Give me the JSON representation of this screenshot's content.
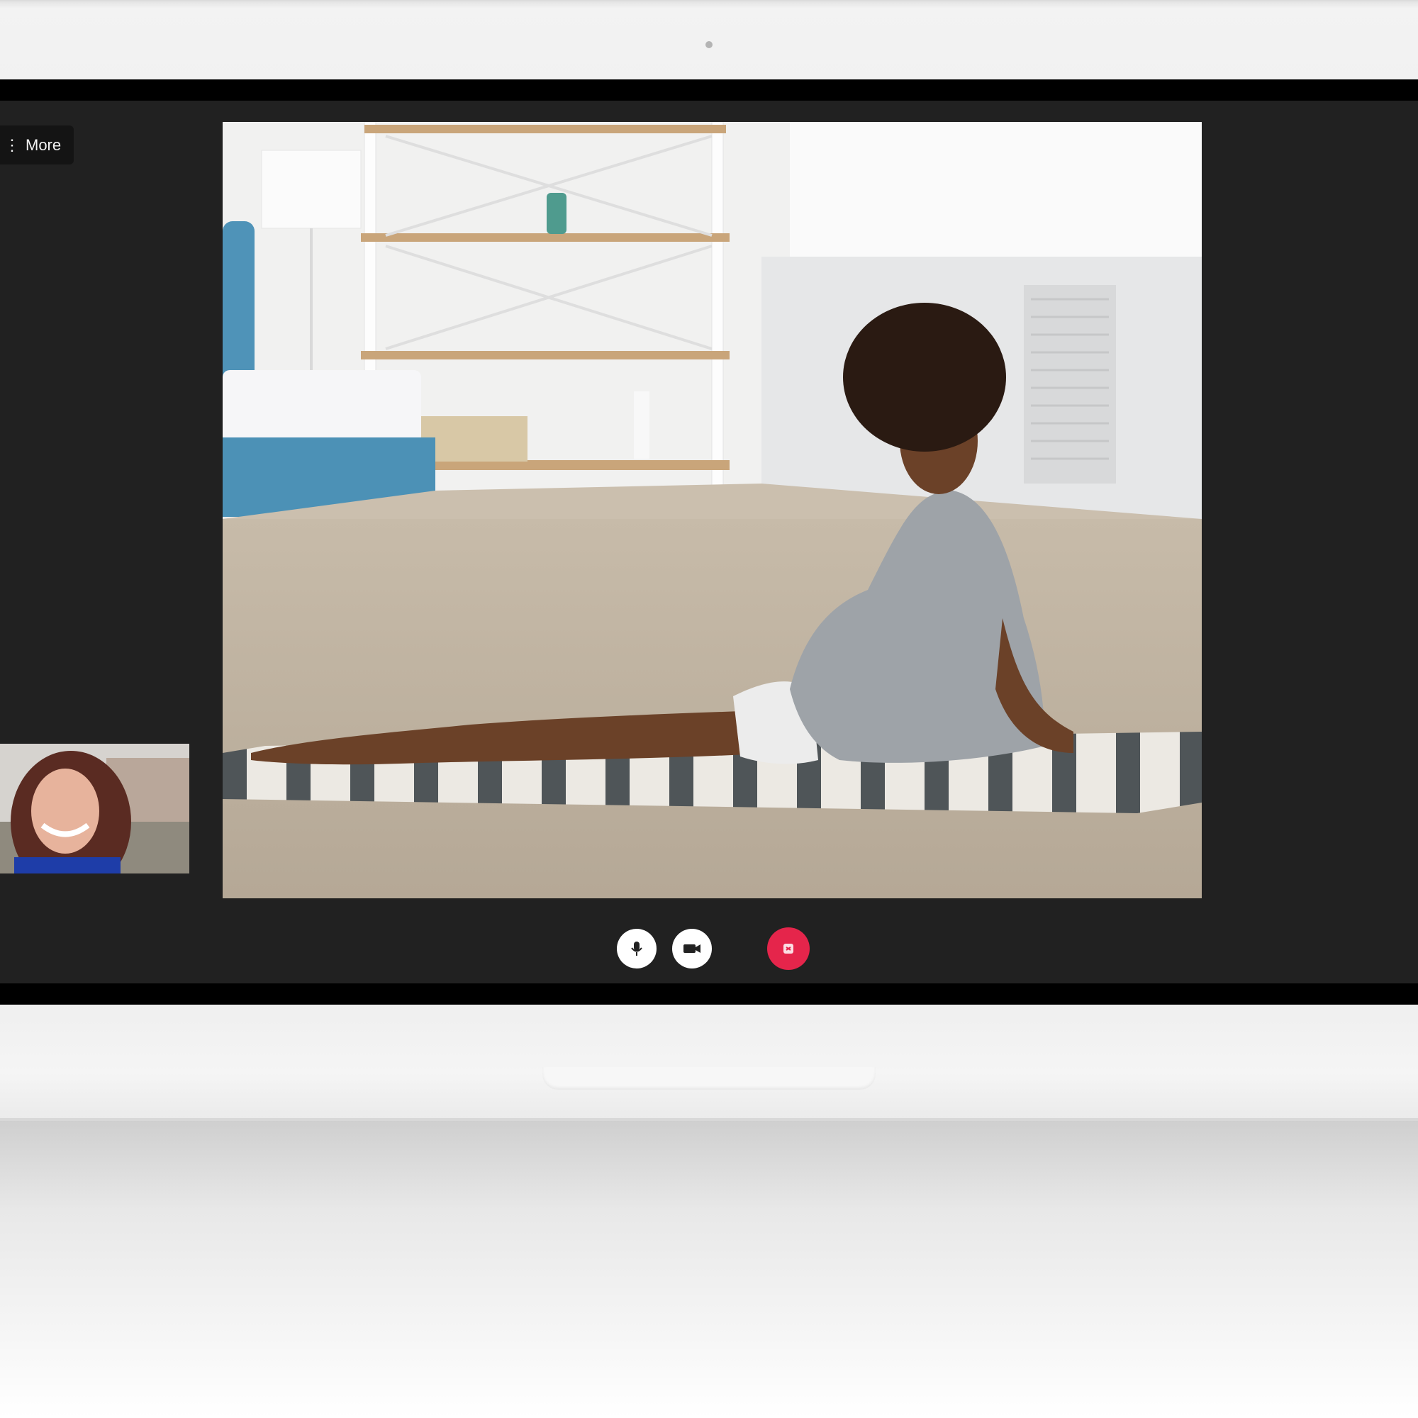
{
  "toolbar": {
    "more_label": "More"
  },
  "controls": {
    "mic_icon": "microphone-icon",
    "camera_icon": "video-camera-icon",
    "end_icon": "end-call-icon"
  },
  "colors": {
    "call_background": "#212121",
    "end_call": "#e5254b",
    "control_button": "#ffffff"
  }
}
